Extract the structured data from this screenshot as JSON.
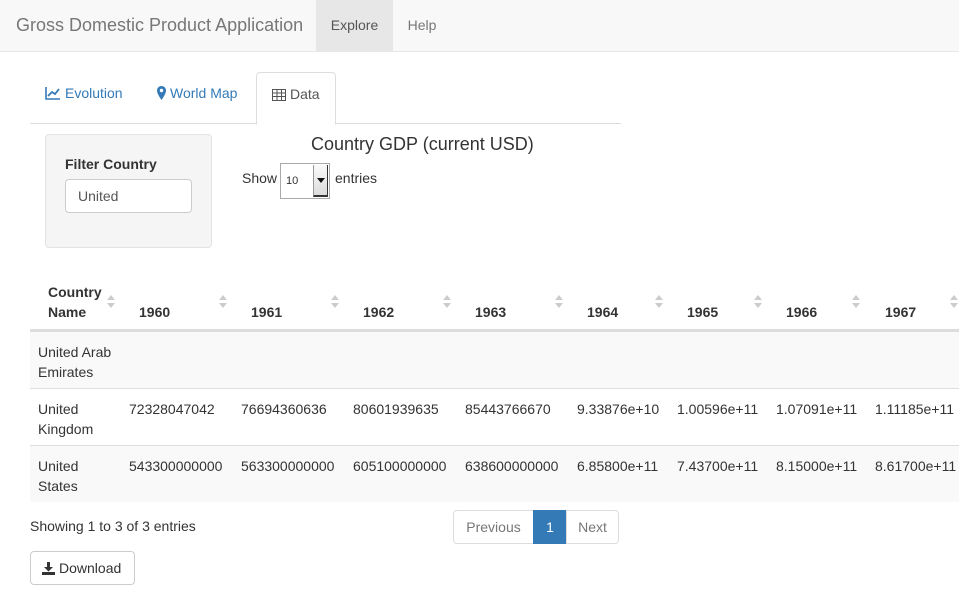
{
  "navbar": {
    "brand": "Gross Domestic Product Application",
    "items": [
      {
        "label": "Explore",
        "active": true
      },
      {
        "label": "Help",
        "active": false
      }
    ]
  },
  "tabs": [
    {
      "label": "Evolution",
      "icon": "line-chart-icon",
      "active": false
    },
    {
      "label": "World Map",
      "icon": "map-marker-icon",
      "active": false
    },
    {
      "label": "Data",
      "icon": "table-icon",
      "active": true
    }
  ],
  "filter": {
    "label": "Filter Country",
    "value": "United"
  },
  "table": {
    "title": "Country GDP (current USD)",
    "length": {
      "show_label": "Show",
      "value": "10",
      "entries_label": "entries"
    },
    "columns": [
      "Country Name",
      "1960",
      "1961",
      "1962",
      "1963",
      "1964",
      "1965",
      "1966",
      "1967"
    ],
    "rows": [
      {
        "name": "United Arab Emirates",
        "values": [
          "",
          "",
          "",
          "",
          "",
          "",
          "",
          ""
        ]
      },
      {
        "name": "United Kingdom",
        "values": [
          "72328047042",
          "76694360636",
          "80601939635",
          "85443766670",
          "9.33876e+10",
          "1.00596e+11",
          "1.07091e+11",
          "1.11185e+11"
        ]
      },
      {
        "name": "United States",
        "values": [
          "543300000000",
          "563300000000",
          "605100000000",
          "638600000000",
          "6.85800e+11",
          "7.43700e+11",
          "8.15000e+11",
          "8.61700e+11"
        ]
      }
    ],
    "info": "Showing 1 to 3 of 3 entries",
    "pagination": {
      "previous": "Previous",
      "current": "1",
      "next": "Next"
    }
  },
  "download": {
    "label": "Download",
    "icon": "download-icon"
  },
  "colors": {
    "link": "#337ab7",
    "active_page": "#337ab7",
    "navbar_bg": "#f8f8f8"
  }
}
